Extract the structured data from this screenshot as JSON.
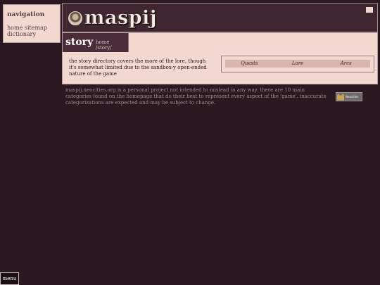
{
  "navigation": {
    "title": "navigation",
    "links": [
      {
        "label": "home"
      },
      {
        "label": "sitemap"
      },
      {
        "label": "dictionary"
      }
    ]
  },
  "header": {
    "site_name": "maspij",
    "logo_icon": "portrait-emblem-icon"
  },
  "page": {
    "title": "story",
    "breadcrumb": [
      "home",
      "/story/"
    ],
    "description": "the story directory covers the more of the lore, though it's somewhat limited due to the sandbox-y open-ended nature of the game"
  },
  "categories": [
    "Quests",
    "Lore",
    "Arcs"
  ],
  "footer": {
    "text": "maspij.neocities.org is a personal project not intended to mislead in any way. there are 10 main categories found on the homepage that do their best to represent every aspect of the 'game'. inaccurate categorizations are expected and may be subject to change.",
    "badge_text": "Neocities"
  },
  "menu": {
    "label": "menu"
  },
  "colors": {
    "background": "#2b1820",
    "panel": "#f2d8cf",
    "header": "#3f2631",
    "title_tab": "#4a2d39",
    "category_row": "#d8b6ac"
  }
}
